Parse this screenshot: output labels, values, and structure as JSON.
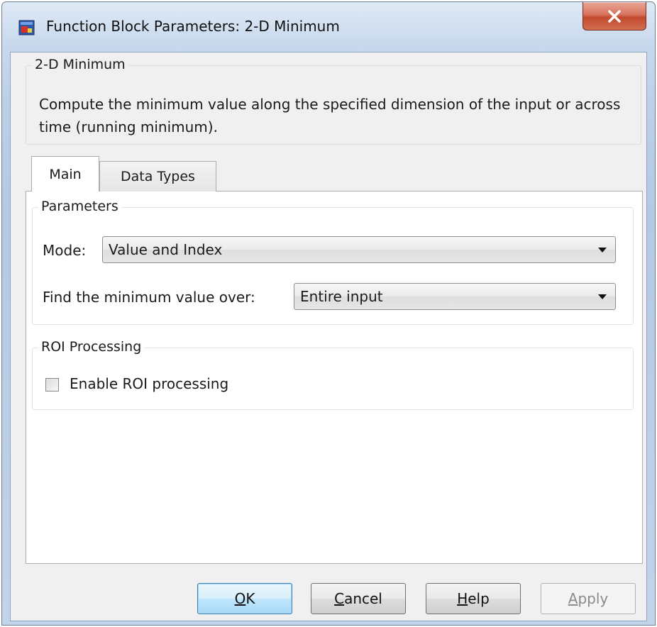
{
  "window": {
    "title": "Function Block Parameters: 2-D Minimum",
    "app_icon": "simulink-block-icon",
    "close_icon": "close-icon"
  },
  "description": {
    "group_title": "2-D Minimum",
    "text": "Compute the minimum value along the specified dimension of the input or across time (running minimum)."
  },
  "tabs": [
    {
      "label": "Main",
      "selected": true
    },
    {
      "label": "Data Types",
      "selected": false
    }
  ],
  "parameters": {
    "group_title": "Parameters",
    "mode_label": "Mode:",
    "mode_value": "Value and Index",
    "find_label": "Find the minimum value over:",
    "find_value": "Entire input"
  },
  "roi": {
    "group_title": "ROI Processing",
    "checkbox_label": "Enable ROI processing",
    "checked": false
  },
  "buttons": {
    "ok": {
      "mnemonic": "O",
      "rest": "K"
    },
    "cancel": {
      "mnemonic": "C",
      "rest": "ancel"
    },
    "help": {
      "mnemonic": "H",
      "rest": "elp"
    },
    "apply": {
      "mnemonic": "A",
      "rest": "pply",
      "enabled": false
    }
  },
  "colors": {
    "titlebar": "#c8d9ed",
    "close_button": "#c2492d",
    "dialog_bg": "#f0f0f0",
    "ok_button": "#bee6fd"
  }
}
